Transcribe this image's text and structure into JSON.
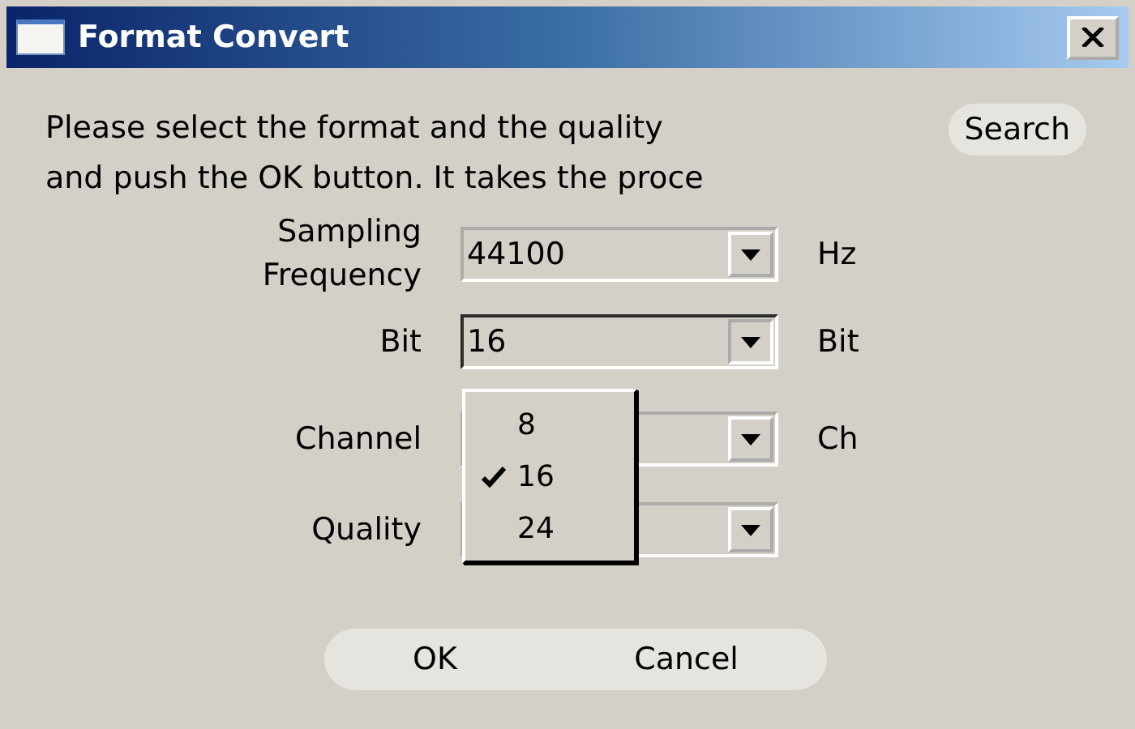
{
  "window": {
    "title": "Format Convert"
  },
  "instructions": [
    "Please select the format and the quality",
    "and push the OK button. It takes the proce"
  ],
  "search_button": "Search",
  "fields": [
    {
      "label": "Sampling Frequency",
      "value": "44100",
      "unit": "Hz",
      "open": false
    },
    {
      "label": "Bit",
      "value": "16",
      "unit": "Bit",
      "open": true
    },
    {
      "label": "Channel",
      "unit": "Ch",
      "open": false
    },
    {
      "label": "Quality",
      "open": false
    }
  ],
  "dropdown": {
    "options": [
      {
        "label": "8",
        "selected": false
      },
      {
        "label": "16",
        "selected": true
      },
      {
        "label": "24",
        "selected": false
      }
    ]
  },
  "buttons": [
    "OK",
    "Cancel"
  ]
}
